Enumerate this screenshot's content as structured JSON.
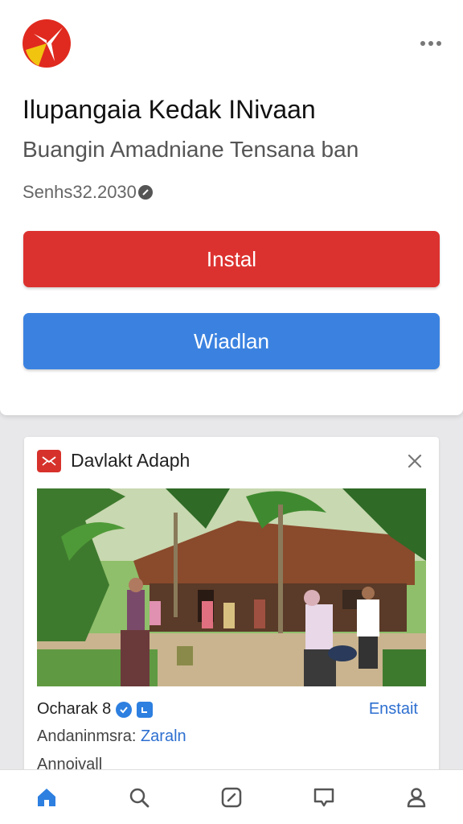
{
  "app": {
    "title": "Ilupangaia Kedak INivaan",
    "subtitle": "Buangin Amadniane Tensana ban",
    "meta": "Senhs32.2030",
    "logo_icon": "pinwheel-logo"
  },
  "buttons": {
    "install_label": "Instal",
    "secondary_label": "Wiadlan"
  },
  "ad": {
    "name": "Davlakt Adaph",
    "author": "Ocharak 8",
    "action_label": "Enstait",
    "description_prefix": "Andaninmsra: ",
    "description_link": "Zaraln",
    "extra": "Annoivall"
  },
  "bottom_nav": {
    "items": [
      "home-icon",
      "search-icon",
      "compose-icon",
      "messages-icon",
      "profile-icon"
    ],
    "active": "home-icon"
  },
  "colors": {
    "install_red": "#dc322f",
    "secondary_blue": "#3b82e0",
    "link_blue": "#2d6fd0"
  }
}
